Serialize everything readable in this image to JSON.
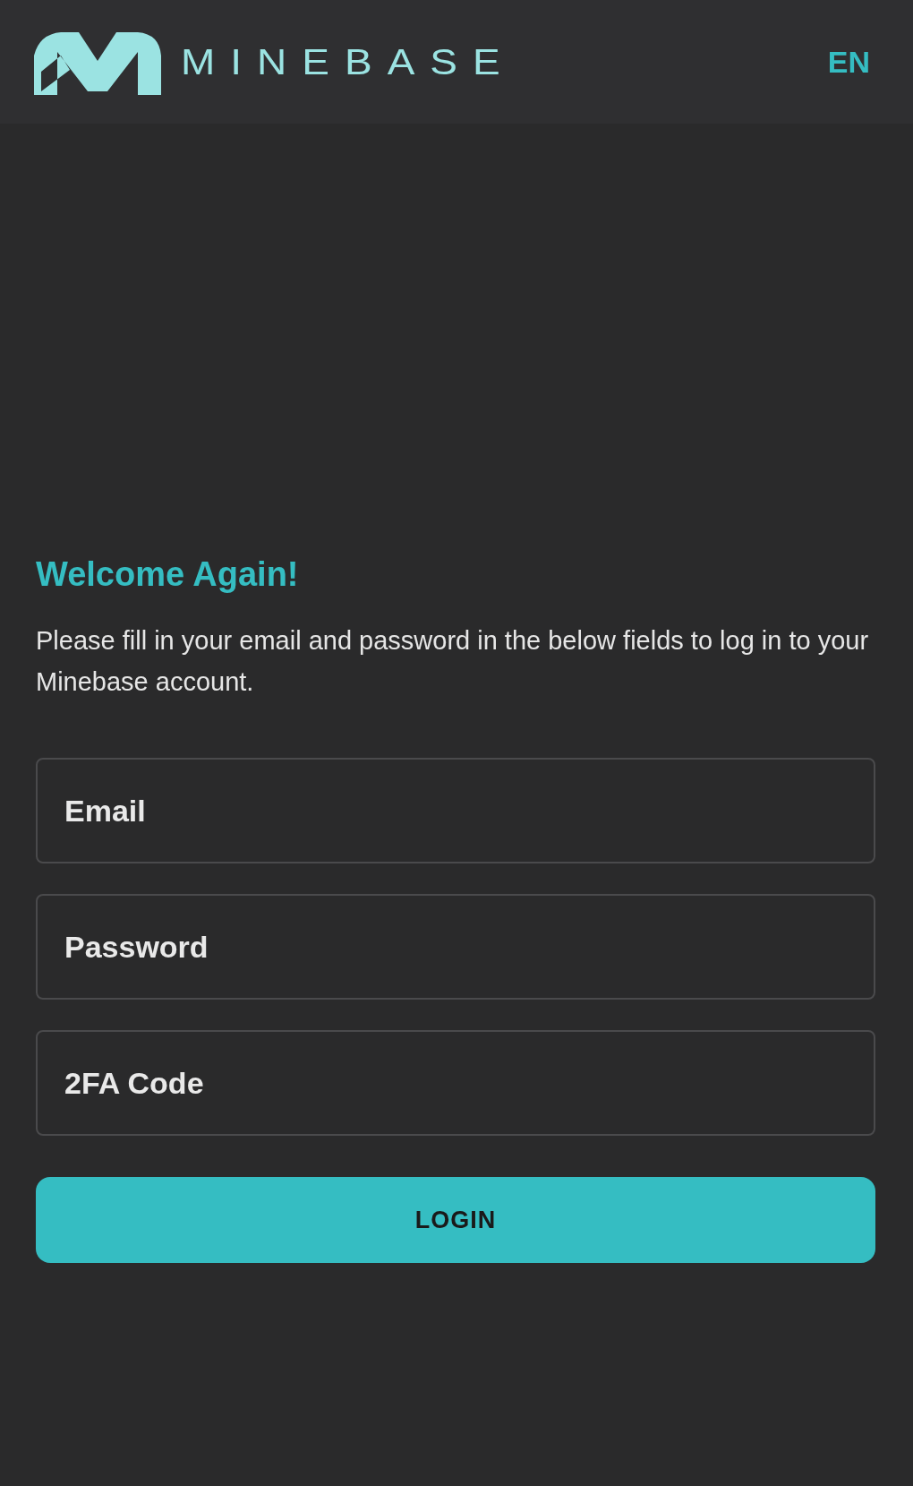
{
  "header": {
    "logo_text": "MINEBASE",
    "language": "EN"
  },
  "heading": "Welcome Again!",
  "intro": "Please fill in your email and password in the below fields to log in to your Minebase account.",
  "fields": [
    {
      "placeholder": "Email"
    },
    {
      "placeholder": "Password"
    },
    {
      "placeholder": "2FA Code"
    }
  ],
  "button": "LOGIN"
}
